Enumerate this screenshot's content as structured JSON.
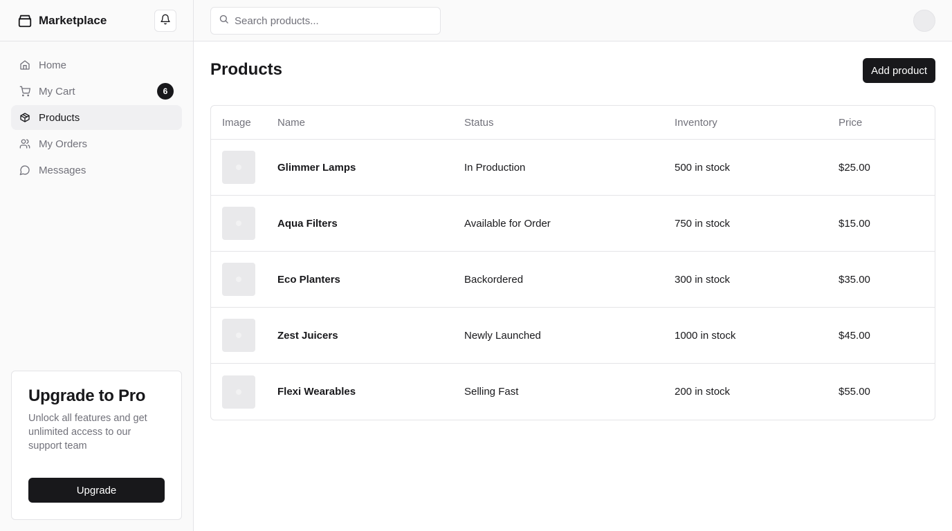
{
  "brand": {
    "name": "Marketplace",
    "icon": "package-icon"
  },
  "sidebar": {
    "items": [
      {
        "label": "Home",
        "icon": "home-icon"
      },
      {
        "label": "My Cart",
        "icon": "cart-icon",
        "badge": "6"
      },
      {
        "label": "Products",
        "icon": "box-icon",
        "active": true
      },
      {
        "label": "My Orders",
        "icon": "users-icon"
      },
      {
        "label": "Messages",
        "icon": "message-icon"
      }
    ],
    "promo": {
      "title": "Upgrade to Pro",
      "text": "Unlock all features and get unlimited access to our support team",
      "button": "Upgrade"
    }
  },
  "search": {
    "placeholder": "Search products...",
    "value": ""
  },
  "main": {
    "title": "Products",
    "add_button": "Add product",
    "table": {
      "headers": [
        "Image",
        "Name",
        "Status",
        "Inventory",
        "Price"
      ],
      "rows": [
        {
          "name": "Glimmer Lamps",
          "status": "In Production",
          "inventory": "500 in stock",
          "price": "$25.00"
        },
        {
          "name": "Aqua Filters",
          "status": "Available for Order",
          "inventory": "750 in stock",
          "price": "$15.00"
        },
        {
          "name": "Eco Planters",
          "status": "Backordered",
          "inventory": "300 in stock",
          "price": "$35.00"
        },
        {
          "name": "Zest Juicers",
          "status": "Newly Launched",
          "inventory": "1000 in stock",
          "price": "$45.00"
        },
        {
          "name": "Flexi Wearables",
          "status": "Selling Fast",
          "inventory": "200 in stock",
          "price": "$55.00"
        }
      ]
    }
  },
  "colors": {
    "primary": "#18181b",
    "muted": "#71717a",
    "border": "#e4e4e7",
    "sidebar_bg": "#fafafa"
  }
}
